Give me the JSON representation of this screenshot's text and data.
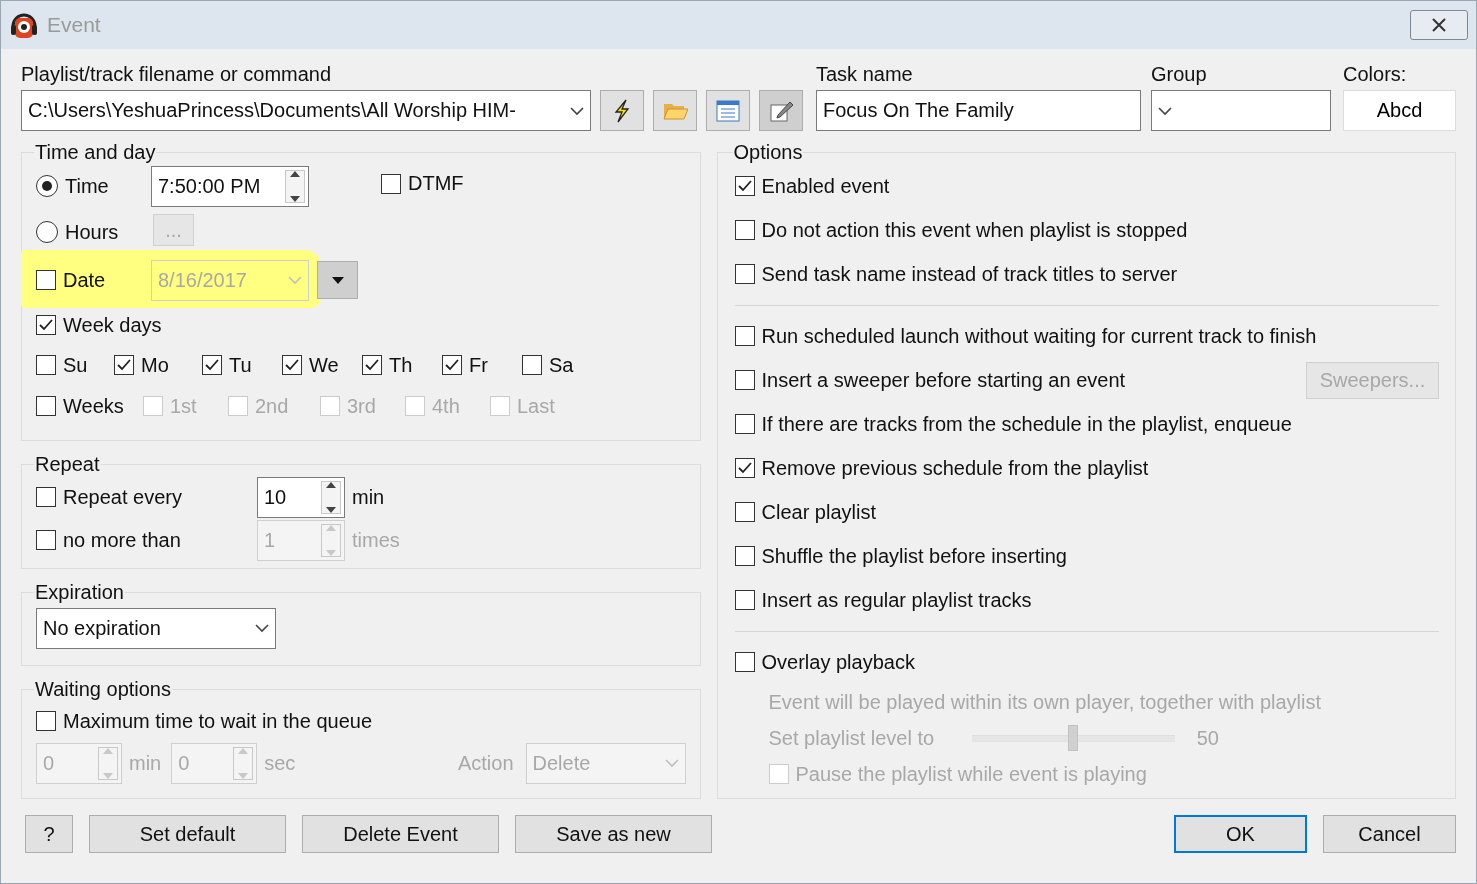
{
  "window": {
    "title": "Event"
  },
  "source": {
    "label": "Playlist/track filename or command",
    "value": "C:\\Users\\YeshuaPrincess\\Documents\\All Worship HIM-"
  },
  "task_name": {
    "label": "Task name",
    "value": "Focus On The Family"
  },
  "group": {
    "label": "Group"
  },
  "colors": {
    "label": "Colors:",
    "sample": "Abcd"
  },
  "time_and_day": {
    "title": "Time and day",
    "modes": [
      {
        "label": "Time",
        "selected": true
      },
      {
        "label": "Hours",
        "selected": false
      }
    ],
    "time_value": "7:50:00 PM",
    "hours_button": {
      "label": "...",
      "disabled": true
    },
    "dtmf": {
      "label": "DTMF",
      "checked": false
    },
    "date": {
      "label": "Date",
      "checked": false,
      "value": "8/16/2017",
      "disabled": true,
      "highlighted": true
    },
    "week_days": {
      "label": "Week days",
      "checked": true
    },
    "days": [
      {
        "label": "Su",
        "checked": false
      },
      {
        "label": "Mo",
        "checked": true
      },
      {
        "label": "Tu",
        "checked": true
      },
      {
        "label": "We",
        "checked": true
      },
      {
        "label": "Th",
        "checked": true
      },
      {
        "label": "Fr",
        "checked": true
      },
      {
        "label": "Sa",
        "checked": false
      }
    ],
    "weeks": {
      "label": "Weeks",
      "checked": false
    },
    "week_numbers": [
      {
        "label": "1st",
        "checked": false,
        "disabled": true
      },
      {
        "label": "2nd",
        "checked": false,
        "disabled": true
      },
      {
        "label": "3rd",
        "checked": false,
        "disabled": true
      },
      {
        "label": "4th",
        "checked": false,
        "disabled": true
      },
      {
        "label": "Last",
        "checked": false,
        "disabled": true
      }
    ]
  },
  "repeat": {
    "title": "Repeat",
    "rows": [
      {
        "label": "Repeat every",
        "checked": false,
        "value": "10",
        "unit": "min",
        "disabled": false
      },
      {
        "label": "no more than",
        "checked": false,
        "value": "1",
        "unit": "times",
        "disabled": true
      }
    ]
  },
  "expiration": {
    "title": "Expiration",
    "value": "No expiration"
  },
  "waiting": {
    "title": "Waiting options",
    "max_wait": {
      "label": "Maximum time to wait in the queue",
      "checked": false
    },
    "min_value": "0",
    "min_unit": "min",
    "sec_value": "0",
    "sec_unit": "sec",
    "disabled": true,
    "action_label": "Action",
    "action_value": "Delete"
  },
  "options": {
    "title": "Options",
    "items": [
      {
        "kind": "check",
        "label": "Enabled event",
        "checked": true
      },
      {
        "kind": "check",
        "label": "Do not action this event when playlist is stopped",
        "checked": false
      },
      {
        "kind": "check",
        "label": "Send task name instead of track titles to server",
        "checked": false
      },
      {
        "kind": "separator"
      },
      {
        "kind": "check",
        "label": "Run scheduled launch without waiting for current track to finish",
        "checked": false
      },
      {
        "kind": "check",
        "label": "Insert a sweeper before starting an event",
        "checked": false,
        "button": {
          "label": "Sweepers...",
          "disabled": true
        }
      },
      {
        "kind": "check",
        "label": "If there are tracks from the schedule in the playlist, enqueue",
        "checked": false
      },
      {
        "kind": "check",
        "label": "Remove previous schedule from the playlist",
        "checked": true
      },
      {
        "kind": "check",
        "label": "Clear playlist",
        "checked": false
      },
      {
        "kind": "check",
        "label": "Shuffle the playlist before inserting",
        "checked": false
      },
      {
        "kind": "check",
        "label": "Insert as regular playlist tracks",
        "checked": false
      },
      {
        "kind": "separator"
      },
      {
        "kind": "check",
        "label": "Overlay playback",
        "checked": false,
        "children": [
          {
            "kind": "note",
            "label": "Event will be played within its own player, together with playlist",
            "disabled": true
          },
          {
            "kind": "slider",
            "label": "Set playlist level to",
            "level": 0.5,
            "reading": "50",
            "disabled": true
          },
          {
            "kind": "check",
            "label": "Pause the playlist while event is playing",
            "checked": false,
            "disabled": true
          }
        ]
      }
    ]
  },
  "left_buttons": [
    {
      "label": "?",
      "default": false
    },
    {
      "label": "Set default",
      "default": false
    },
    {
      "label": "Delete Event",
      "default": false
    },
    {
      "label": "Save as new",
      "default": false
    }
  ],
  "right_buttons": [
    {
      "label": "OK",
      "default": true
    },
    {
      "label": "Cancel",
      "default": false
    }
  ]
}
